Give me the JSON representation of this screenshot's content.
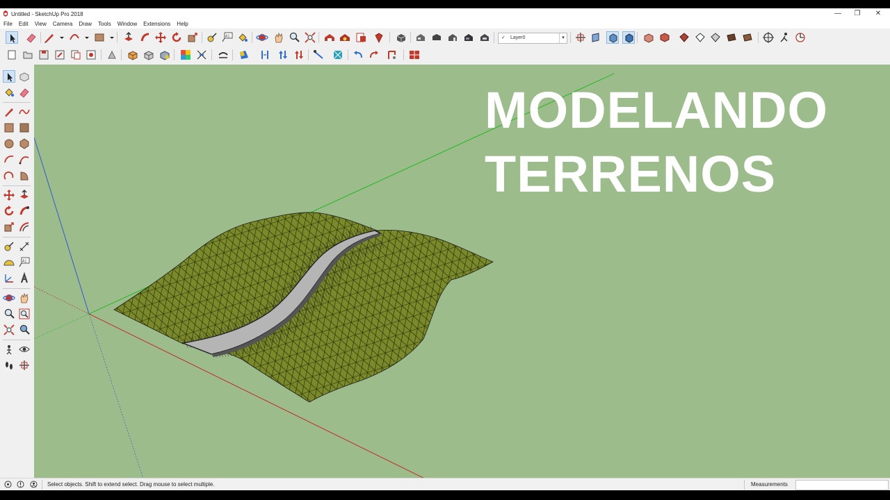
{
  "window": {
    "title": "Untitled - SketchUp Pro 2018",
    "controls": {
      "minimize": "—",
      "restore": "❐",
      "close": "✕"
    }
  },
  "menu": [
    "File",
    "Edit",
    "View",
    "Camera",
    "Draw",
    "Tools",
    "Window",
    "Extensions",
    "Help"
  ],
  "toolbar": {
    "layer": {
      "check": "✓",
      "value": "Layer0"
    }
  },
  "viewport": {
    "background_color": "#9dbc8c",
    "headline": [
      "MODELANDO",
      "TERRENOS"
    ],
    "terrain_color": "#7a8a2a",
    "road_color": "#b5b5b5"
  },
  "status": {
    "hint": "Select objects. Shift to extend select. Drag mouse to select multiple.",
    "measurements_label": "Measurements",
    "measurements_value": ""
  }
}
